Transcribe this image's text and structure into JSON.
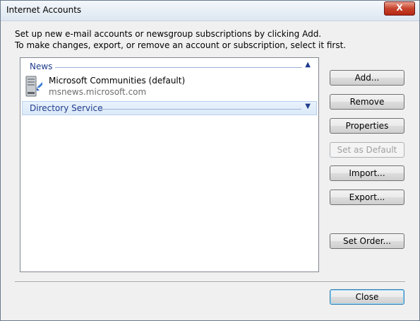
{
  "window": {
    "title": "Internet Accounts",
    "close_glyph": "X"
  },
  "instructions": {
    "line1": "Set up new e-mail accounts or newsgroup subscriptions by clicking Add.",
    "line2": "To make changes, export, or remove an account or subscription, select it first."
  },
  "list": {
    "groups": [
      {
        "label": "News",
        "expanded": true,
        "chevron_icon": "chevron-up-icon"
      },
      {
        "label": "Directory Service",
        "expanded": false,
        "chevron_icon": "chevron-down-icon"
      }
    ],
    "items": [
      {
        "name": "Microsoft Communities (default)",
        "server": "msnews.microsoft.com",
        "icon": "news-server-icon"
      }
    ]
  },
  "buttons": {
    "add": "Add...",
    "remove": "Remove",
    "properties": "Properties",
    "set_default": "Set as Default",
    "import": "Import...",
    "export": "Export...",
    "set_order": "Set Order...",
    "close": "Close"
  },
  "colors": {
    "group_text": "#1e3b8c",
    "close_button": "#c7432c"
  }
}
